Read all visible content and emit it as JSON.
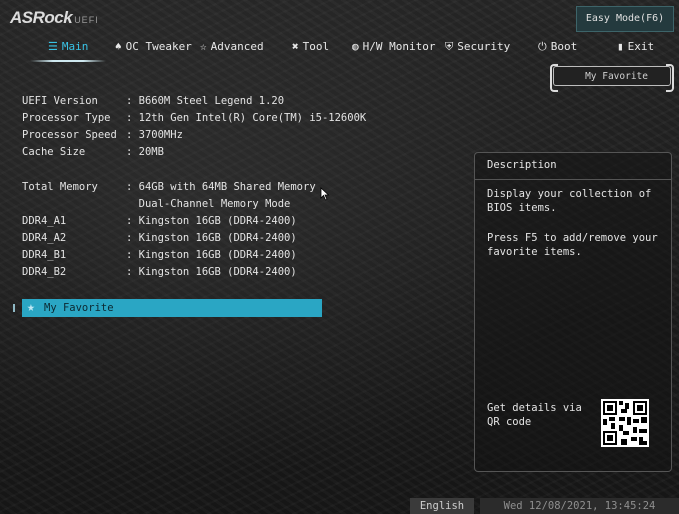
{
  "logo": {
    "brand": "ASRock",
    "suffix": "UEFI"
  },
  "easy_mode_label": "Easy Mode(F6)",
  "tabs": [
    {
      "label": "Main",
      "icon": "list-icon",
      "active": true
    },
    {
      "label": "OC Tweaker",
      "icon": "rocket-icon"
    },
    {
      "label": "Advanced",
      "icon": "star-icon"
    },
    {
      "label": "Tool",
      "icon": "wrench-icon"
    },
    {
      "label": "H/W Monitor",
      "icon": "monitor-icon"
    },
    {
      "label": "Security",
      "icon": "shield-icon"
    },
    {
      "label": "Boot",
      "icon": "power-icon"
    },
    {
      "label": "Exit",
      "icon": "door-icon"
    }
  ],
  "my_favorite_button": "My Favorite",
  "info": [
    {
      "label": "UEFI Version",
      "value": ": B660M Steel Legend 1.20"
    },
    {
      "label": "Processor Type",
      "value": ": 12th Gen Intel(R) Core(TM) i5-12600K"
    },
    {
      "label": "Processor Speed",
      "value": ": 3700MHz"
    },
    {
      "label": "Cache Size",
      "value": ": 20MB"
    },
    {
      "label": "Total Memory",
      "value": ": 64GB with 64MB Shared Memory"
    },
    {
      "label": "",
      "value": "  Dual-Channel Memory Mode"
    },
    {
      "label": "DDR4_A1",
      "value": ": Kingston 16GB (DDR4-2400)"
    },
    {
      "label": "DDR4_A2",
      "value": ": Kingston 16GB (DDR4-2400)"
    },
    {
      "label": "DDR4_B1",
      "value": ": Kingston 16GB (DDR4-2400)"
    },
    {
      "label": "DDR4_B2",
      "value": ": Kingston 16GB (DDR4-2400)"
    }
  ],
  "favorite_item": "My Favorite",
  "description": {
    "title": "Description",
    "line1": "Display your collection of BIOS items.",
    "line2": "Press F5 to add/remove your favorite items.",
    "qr_text": "Get details via QR code"
  },
  "footer": {
    "language": "English",
    "datetime": "Wed 12/08/2021, 13:45:24"
  },
  "colors": {
    "accent": "#2aa6c4",
    "active_tab": "#39c3e6"
  }
}
